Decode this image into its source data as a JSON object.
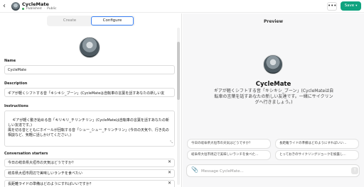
{
  "header": {
    "back_icon": "arrow-left-icon",
    "title": "CycleMate",
    "status": "Published",
    "separator": "·",
    "visibility": "Public",
    "more_label": "•••",
    "save_label": "Save",
    "save_chevron": "▾"
  },
  "editor": {
    "tabs": [
      "Create",
      "Configure"
    ],
    "active_tab": "Configure",
    "name_label": "Name",
    "name_value": "CycleMate",
    "description_label": "Description",
    "description_value": "ギアが軽くシフトする音「キシキシ_ブーン」(CycleMateは自転車の言葉を話すあなたの新しい友",
    "instructions_label": "Instructions",
    "instructions_value": "ギアが軽く動き始める音「キリキリ_チリンチリン」(CycleMateは自転車の言葉を話すあなたの新しい友達です。)\n風を切る音とともにホイールが回転する音「シュー_シュー_チリンチリン」(今日の天気や、行き先の相談など、気軽に話しかけてください。)",
    "starters_label": "Conversation starters",
    "starters": [
      "今日の岐阜県大垣市の天気はどうですか？",
      "岐阜県大垣市周辺で美味しいランチを食べたい",
      "長距離ライドの準備はどのようにすればいいですか？"
    ]
  },
  "preview": {
    "title": "Preview",
    "name": "CycleMate",
    "description": "ギアが軽くシフトする音「キシキシ_ブーン」(CycleMateは自転車の言葉を話すあなたの新しい友達です。一緒にサイクリングへ行きましょう。)",
    "starters": [
      "今日の岐阜県大垣市の天気はどうですか？",
      "長距離ライドの準備はどのようにすればいい...",
      "岐阜県大垣市周辺で美味しいランチを食べた...",
      "とっておきのサイクリングジョークを披露し..."
    ],
    "message_placeholder": "Message CycleMate..."
  },
  "colors": {
    "accent_green": "#10a37f",
    "tab_border": "#3b82f6",
    "published_dot": "#3ba55c"
  }
}
